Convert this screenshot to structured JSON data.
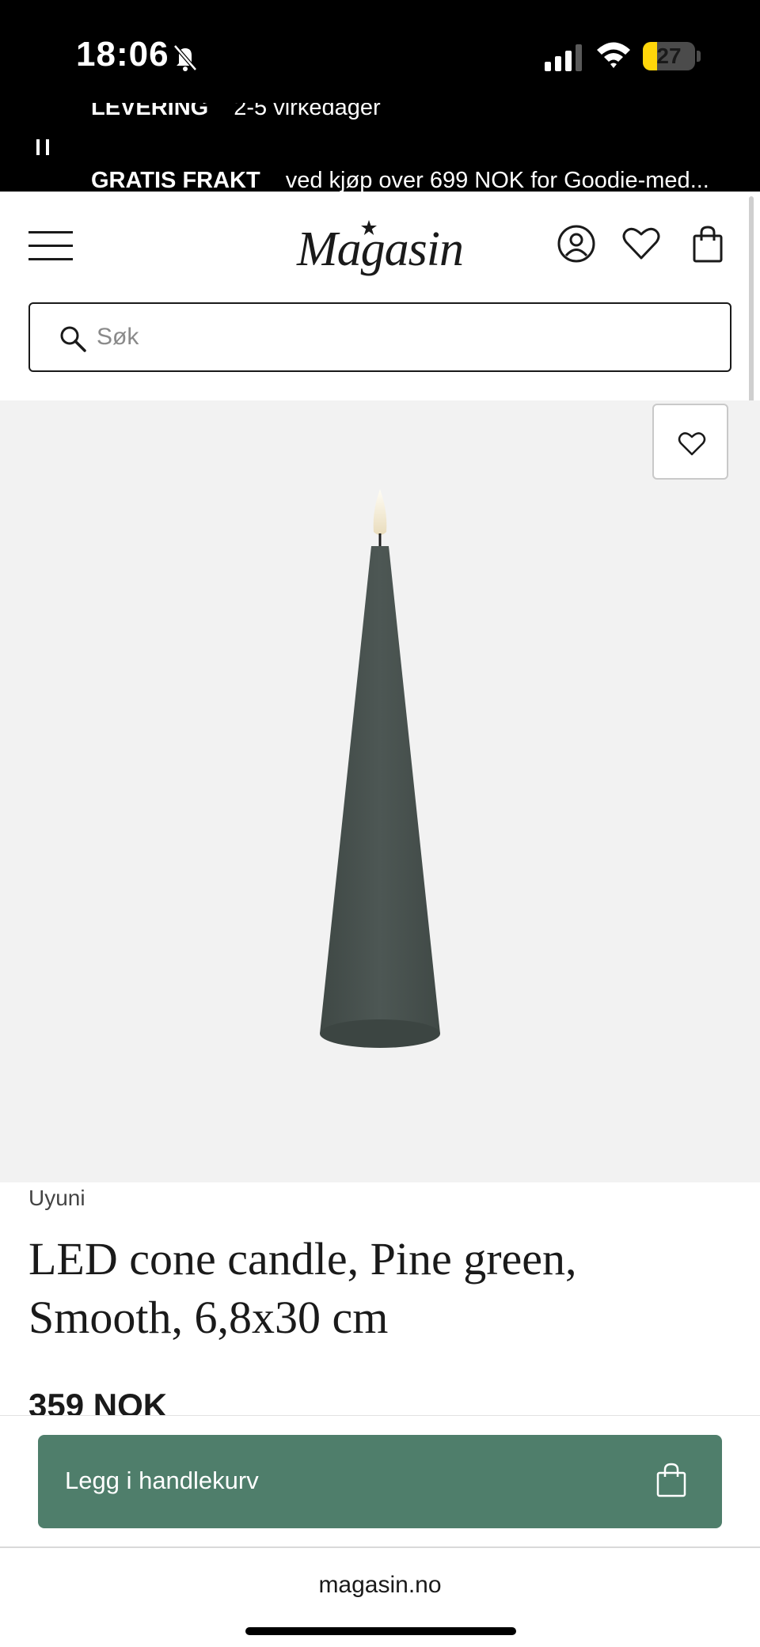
{
  "status_bar": {
    "time": "18:06",
    "battery_level": "27",
    "battery_fraction": 0.27
  },
  "ticker": {
    "line1_label": "LEVERING",
    "line1_text": "2-5 virkedager",
    "line2_label": "GRATIS FRAKT",
    "line2_text": "ved kjøp over 699 NOK for Goodie-med..."
  },
  "header": {
    "logo": "Magasin",
    "search_placeholder": "Søk"
  },
  "product": {
    "brand": "Uyuni",
    "title_line1": "LED cone candle, Pine green,",
    "title_line2": "Smooth, 6,8x30 cm",
    "price": "359 NOK",
    "candle_color": "#48524f"
  },
  "cart": {
    "add_label": "Legg i handlekurv",
    "button_color": "#4f7e6b"
  },
  "browser": {
    "url": "magasin.no"
  },
  "icons": {
    "menu": "hamburger-menu-icon",
    "account": "user-icon",
    "wishlist": "heart-icon",
    "bag": "shopping-bag-icon",
    "search": "search-icon"
  }
}
